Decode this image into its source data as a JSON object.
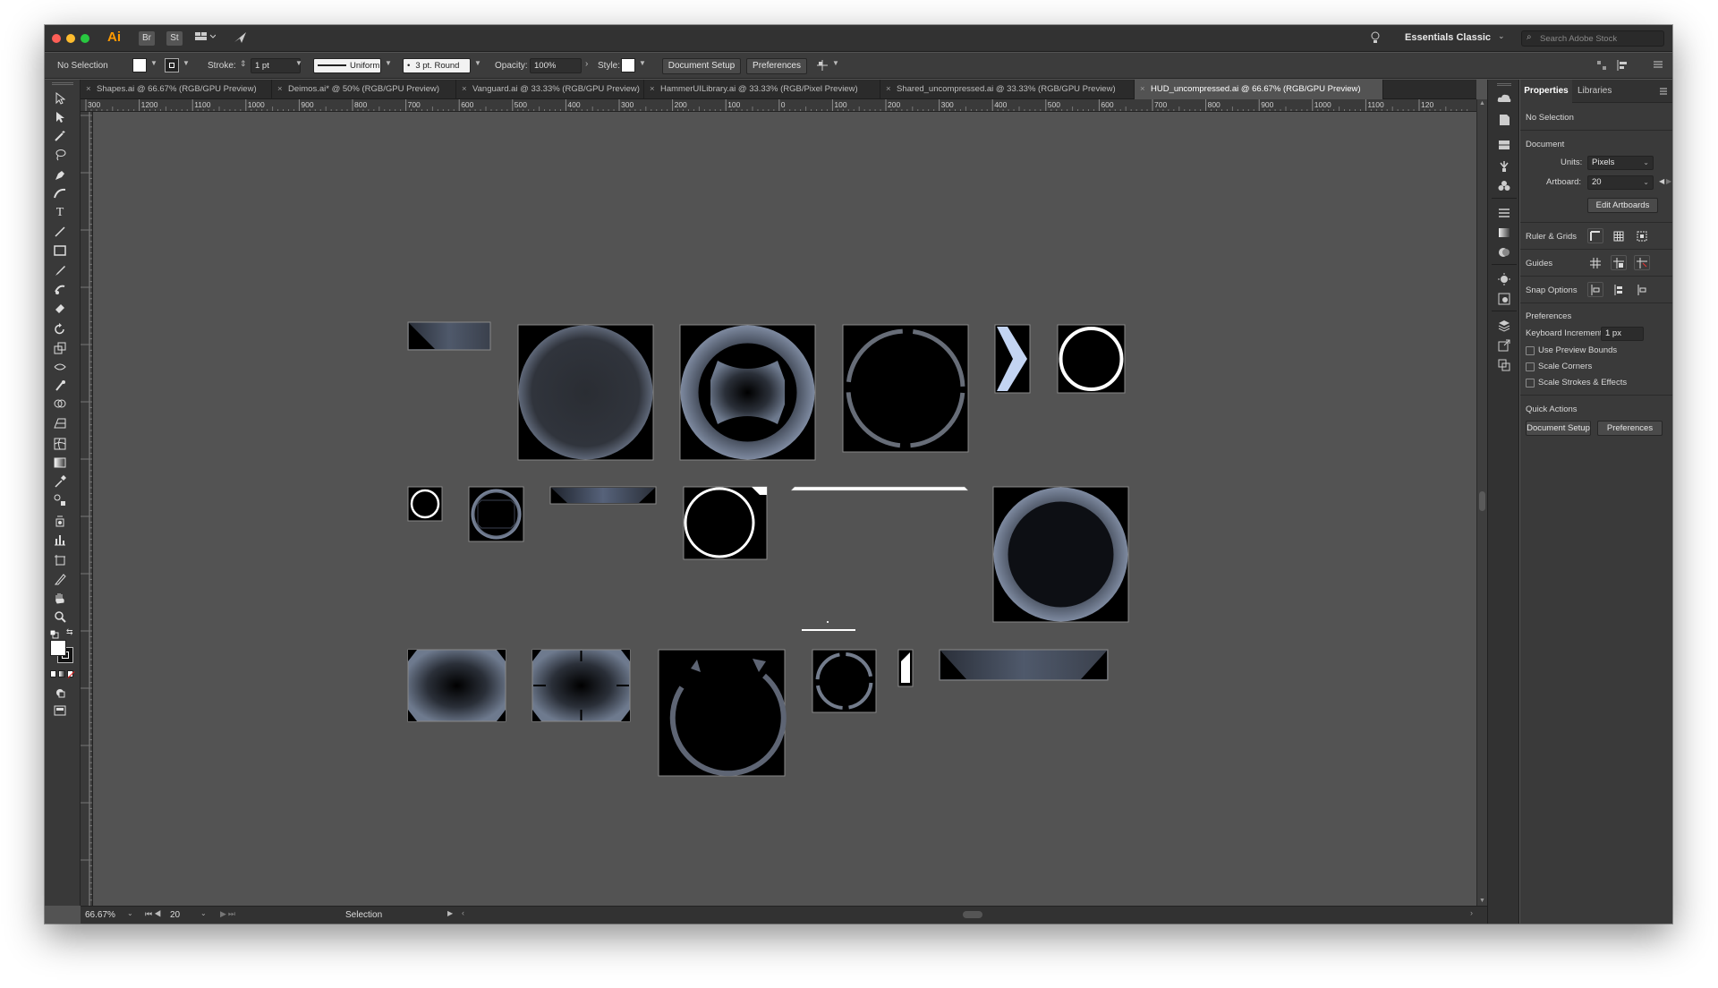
{
  "app": {
    "logo": "Ai",
    "bridge": "Br",
    "stock": "St",
    "workspace": "Essentials Classic",
    "search_placeholder": "Search Adobe Stock"
  },
  "control": {
    "selection": "No Selection",
    "stroke_label": "Stroke:",
    "stroke_value": "1 pt",
    "profile": "Uniform",
    "brush": "3 pt. Round",
    "opacity_label": "Opacity:",
    "opacity_value": "100%",
    "style_label": "Style:",
    "document_setup": "Document Setup",
    "preferences": "Preferences"
  },
  "tabs": [
    {
      "label": "Shapes.ai @ 66.67% (RGB/GPU Preview)"
    },
    {
      "label": "Deimos.ai* @ 50% (RGB/GPU Preview)"
    },
    {
      "label": "Vanguard.ai @ 33.33% (RGB/GPU Preview)"
    },
    {
      "label": "HammerUILibrary.ai @ 33.33% (RGB/Pixel Preview)"
    },
    {
      "label": "Shared_uncompressed.ai @ 33.33% (RGB/GPU Preview)"
    },
    {
      "label": "HUD_uncompressed.ai @ 66.67% (RGB/GPU Preview)"
    }
  ],
  "ruler": {
    "h": [
      "300",
      "1200",
      "1100",
      "1000",
      "900",
      "800",
      "700",
      "600",
      "500",
      "400",
      "300",
      "200",
      "100",
      "0",
      "100",
      "200",
      "300",
      "400",
      "500",
      "600",
      "700",
      "800",
      "900",
      "1000",
      "1100",
      "120"
    ]
  },
  "status": {
    "zoom": "66.67%",
    "artboard": "20",
    "tool": "Selection"
  },
  "panel": {
    "tab_properties": "Properties",
    "tab_libraries": "Libraries",
    "selection": "No Selection",
    "document": "Document",
    "units_label": "Units:",
    "units_value": "Pixels",
    "artboard_label": "Artboard:",
    "artboard_value": "20",
    "edit_artboards": "Edit Artboards",
    "rulers_grids": "Ruler & Grids",
    "guides": "Guides",
    "snap_options": "Snap Options",
    "preferences": "Preferences",
    "keyboard_increment_label": "Keyboard Increment:",
    "keyboard_increment_value": "1 px",
    "use_preview_bounds": "Use Preview Bounds",
    "scale_corners": "Scale Corners",
    "scale_strokes": "Scale Strokes & Effects",
    "quick_actions": "Quick Actions",
    "qa_document_setup": "Document Setup",
    "qa_preferences": "Preferences"
  },
  "colors": {
    "canvas": "#535353",
    "chrome": "#3a3a3a",
    "chevron": "#c3d4f2",
    "artwork_fill": "#000000"
  }
}
